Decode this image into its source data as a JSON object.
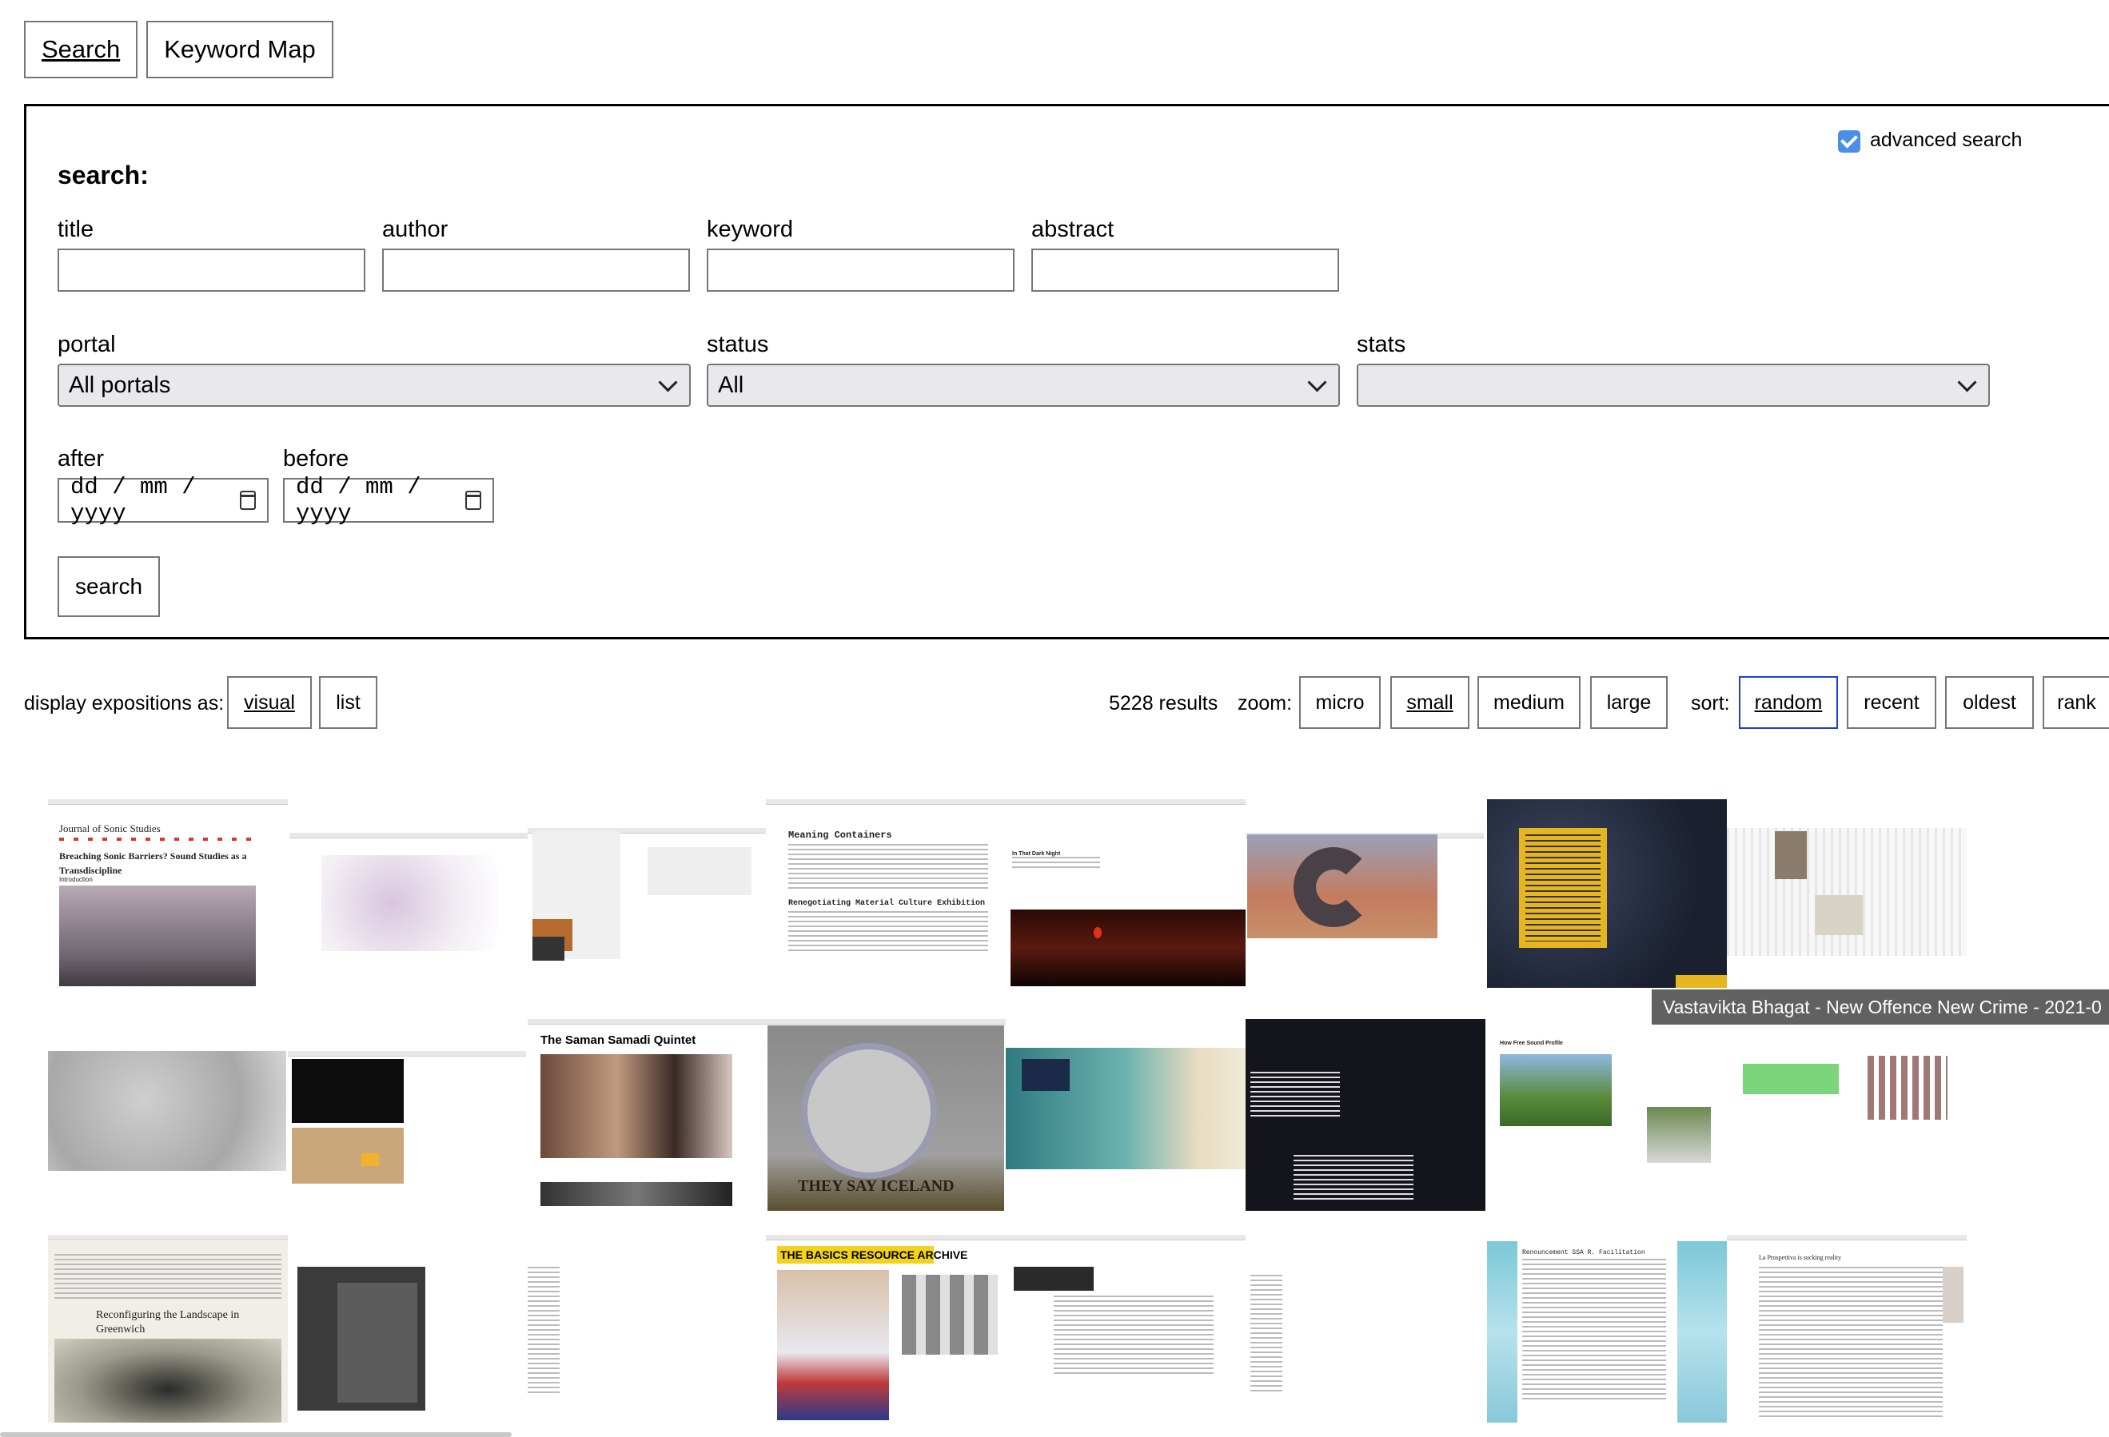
{
  "nav": {
    "search_label": "Search",
    "keyword_map_label": "Keyword Map"
  },
  "search": {
    "heading": "search:",
    "advanced_label": "advanced search",
    "advanced_checked": true,
    "fields": {
      "title": "title",
      "author": "author",
      "keyword": "keyword",
      "abstract": "abstract"
    },
    "portal_label": "portal",
    "portal_value": "All portals",
    "status_label": "status",
    "status_value": "All",
    "stats_label": "stats",
    "stats_value": "",
    "after_label": "after",
    "before_label": "before",
    "date_placeholder": "dd / mm / yyyy",
    "submit_label": "search"
  },
  "display": {
    "label": "display expositions as:",
    "options": [
      "visual",
      "list"
    ],
    "selected": "visual",
    "results": "5228 results",
    "zoom_label": "zoom:",
    "zoom": [
      "micro",
      "small",
      "medium",
      "large"
    ],
    "zoom_selected": "small",
    "sort_label": "sort:",
    "sort": [
      "random",
      "recent",
      "oldest",
      "rank"
    ],
    "sort_selected": "random"
  },
  "tiles": {
    "t1_journal": "Journal of Sonic Studies",
    "t1_title": "Breaching Sonic Barriers? Sound Studies as a Transdiscipline",
    "t1_intro": "Introduction",
    "t4_heading": "Meaning Containers",
    "t4_sub": "Renegotiating Material Culture Exhibition",
    "t5_heading": "In That Dark Night",
    "t9_title": "The Saman Samadi Quintet",
    "t17_title": "Reconfiguring the Landscape in Greenwich",
    "t18_title": "THE BASICS RESOURCE ARCHIVE",
    "t20_title": "Renouncement SSA R. Facilitation",
    "t21_title": "La Prospettiva is sucking reality",
    "t13_title": "How Free Sound Profile",
    "t11_overlay": "THEY SAY ICELAND"
  },
  "tooltip": "Vastavikta Bhagat - New Offence New Crime - 2021-0"
}
